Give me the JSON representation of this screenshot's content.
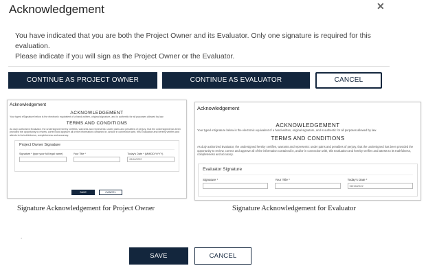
{
  "dialog": {
    "title": "Acknowledgement",
    "close_glyph": "✕",
    "message_line1": "You have indicated that you are both the Project Owner and its Evaluator. Only one signature is required for this evaluation.",
    "message_line2": "Please indicate if you will sign as the Project Owner or the Evaluator.",
    "buttons": {
      "continue_owner": "CONTINUE AS PROJECT OWNER",
      "continue_evaluator": "CONTINUE AS EVALUATOR",
      "cancel": "CANCEL"
    }
  },
  "preview_owner": {
    "header": "Acknowledgement",
    "heading": "ACKNOWLEDGEMENT",
    "esig_text": "Your typed eSignature below is the electronic equivalent of a hand-written, original signature, and is authentic for all purposes allowed by law.",
    "terms_heading": "TERMS AND CONDITIONS",
    "terms_text": "As duly authorized Evaluator, the undersigned hereby certifies, warrants and represents: under pains and penalties of perjury, that the undersigned has been provided the opportunity to review, correct and approve all of the information contained in, and/or in connection with, this Evaluation and hereby verifies and attests to its truthfulness, completeness and accuracy.",
    "panel_title": "Project Owner Signature",
    "fields": [
      {
        "label": "Signature * (type your full legal name)",
        "value": ""
      },
      {
        "label": "Your Title *",
        "value": ""
      },
      {
        "label": "Today's Date * (MM/DD/YYYY)",
        "value": "08/16/2022"
      }
    ],
    "save_label": "SAVE",
    "cancel_label": "CANCEL"
  },
  "preview_evaluator": {
    "header": "Acknowledgement",
    "heading": "ACKNOWLEDGEMENT",
    "esig_text": "Your typed eSignature below is the electronic equivalent of a hand-written, original signature, and is authentic for all purposes allowed by law.",
    "terms_heading": "TERMS AND CONDITIONS",
    "terms_text": "As duly authorized Evaluator, the undersigned hereby certifies, warrants and represents: under pains and penalties of perjury, that the undersigned has been provided the opportunity to review, correct and approve all of the information contained in, and/or in connection with, this Evaluation and hereby verifies and attests to its truthfulness, completeness and accuracy.",
    "panel_title": "Evaluator Signature",
    "fields": [
      {
        "label": "Signature *",
        "value": ""
      },
      {
        "label": "Your Title *",
        "value": ""
      },
      {
        "label": "Today's Date *",
        "value": "08/16/2022"
      }
    ]
  },
  "captions": {
    "owner": "Signature Acknowledgement for Project Owner",
    "evaluator": "Signature Acknowledgement for Evaluator"
  },
  "footer": {
    "dot": ".",
    "save": "SAVE",
    "cancel": "CANCEL"
  },
  "colors": {
    "primary": "#13263d",
    "border": "#c8c8c8"
  }
}
